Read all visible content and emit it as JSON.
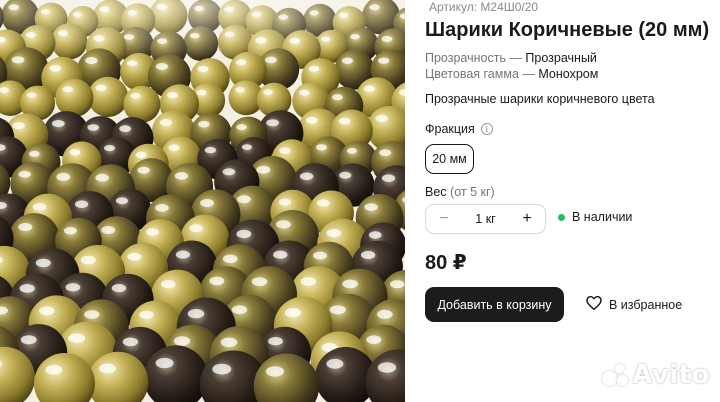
{
  "product": {
    "article": "Артикул: М24Ш0/20",
    "title": "Шарики Коричневые (20 мм)",
    "properties": [
      {
        "label": "Прозрачность — ",
        "value": "Прозрачный"
      },
      {
        "label": "Цветовая гамма — ",
        "value": "Монохром"
      }
    ],
    "description": "Прозрачные шарики коричневого цвета"
  },
  "fraction": {
    "label": "Фракция",
    "info_icon": "info-icon",
    "selected": "20 мм"
  },
  "weight": {
    "label": "Вес",
    "note": "(от 5 кг)",
    "value": "1 кг",
    "minus": "−",
    "plus": "+"
  },
  "stock": {
    "label": "В наличии",
    "color": "#1fbf5c"
  },
  "price": "80 ₽",
  "actions": {
    "add_to_cart": "Добавить в корзину",
    "favorite": "В избранное",
    "favorite_icon": "heart-icon"
  },
  "watermark": "Avito",
  "colors": {
    "button_bg": "#1c1c1e",
    "accent_green": "#1fbf5c"
  }
}
